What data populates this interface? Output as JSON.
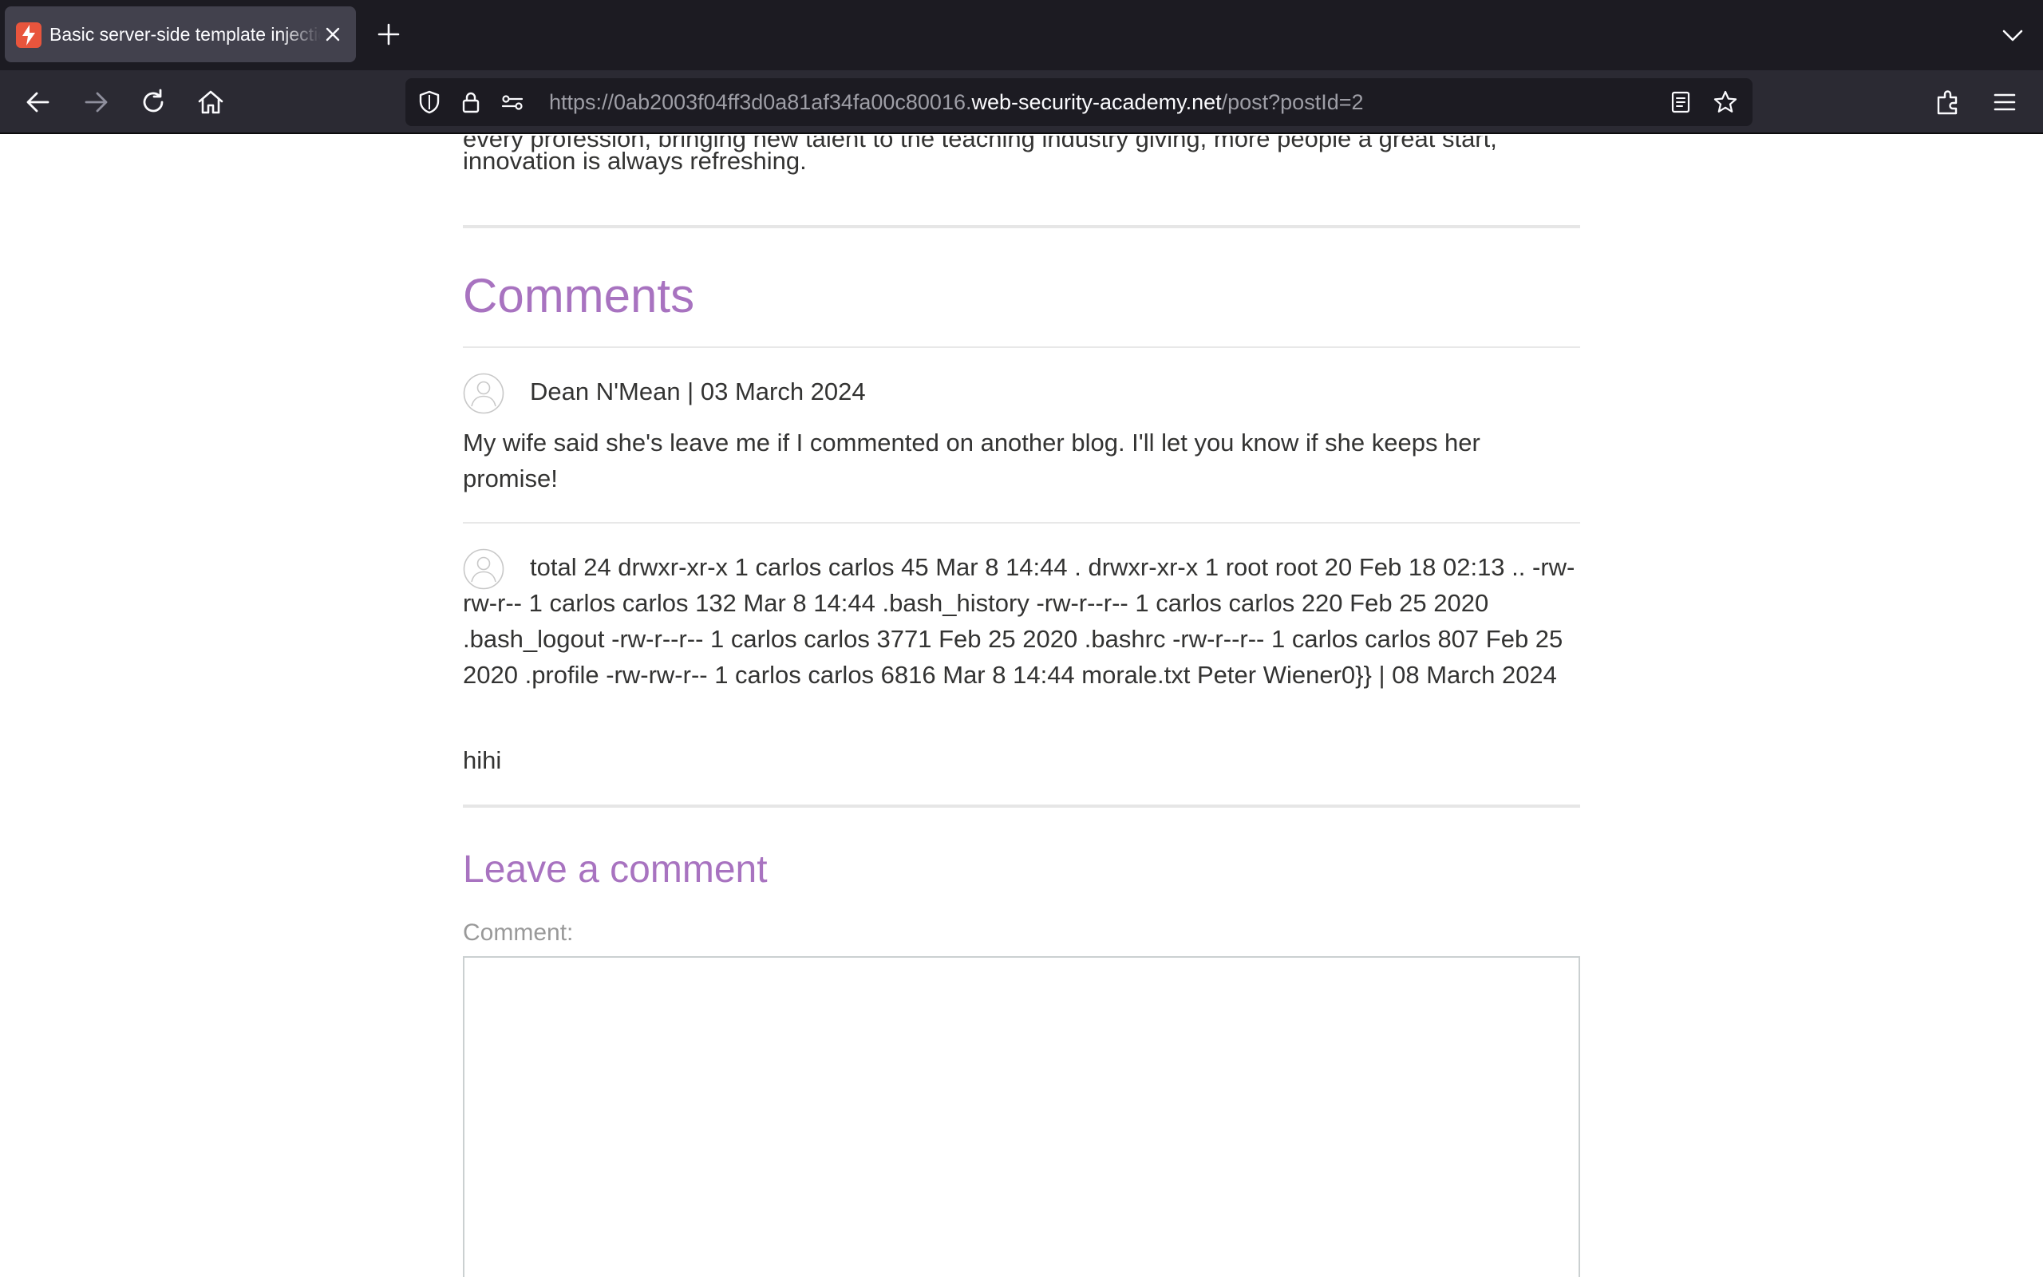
{
  "browser": {
    "tab": {
      "title": "Basic server-side template injection (code context)"
    },
    "url": {
      "prefix": "https://0ab2003f04ff3d0a81af34fa00c80016.",
      "domain": "web-security-academy.net",
      "path": "/post?postId=2"
    }
  },
  "post": {
    "cut_text": "every profession, bringing new talent to the teaching industry giving, more people a great start,",
    "intro_tail": "innovation is always refreshing."
  },
  "comments": {
    "heading": "Comments",
    "items": [
      {
        "header": "Dean N'Mean | 03 March 2024",
        "body": "My wife said she's leave me if I commented on another blog. I'll let you know if she keeps her promise!"
      },
      {
        "header": "total 24 drwxr-xr-x 1 carlos carlos 45 Mar 8 14:44 . drwxr-xr-x 1 root root 20 Feb 18 02:13 .. -rw-rw-r-- 1 carlos carlos 132 Mar 8 14:44 .bash_history -rw-r--r-- 1 carlos carlos 220 Feb 25 2020 .bash_logout -rw-r--r-- 1 carlos carlos 3771 Feb 25 2020 .bashrc -rw-r--r-- 1 carlos carlos 807 Feb 25 2020 .profile -rw-rw-r-- 1 carlos carlos 6816 Mar 8 14:44 morale.txt Peter Wiener0}} | 08 March 2024",
        "body": "hihi"
      }
    ]
  },
  "leave_comment": {
    "heading": "Leave a comment",
    "comment_label": "Comment:",
    "comment_value": ""
  }
}
